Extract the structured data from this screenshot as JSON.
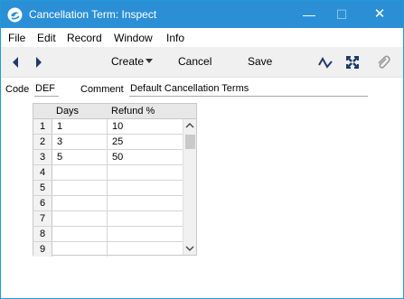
{
  "window": {
    "title": "Cancellation Term: Inspect",
    "controls": {
      "minimize": "—",
      "maximize": "☐",
      "close": "✕"
    }
  },
  "menu": {
    "items": [
      "File",
      "Edit",
      "Record",
      "Window",
      "Info"
    ]
  },
  "toolbar": {
    "create_label": "Create",
    "cancel_label": "Cancel",
    "save_label": "Save",
    "icons": [
      "prev-arrow-icon",
      "next-arrow-icon",
      "dropdown-caret-icon",
      "activity-icon",
      "expand-icon",
      "paperclip-icon"
    ]
  },
  "form": {
    "code_label": "Code",
    "code_value": "DEF",
    "comment_label": "Comment",
    "comment_value": "Default Cancellation Terms"
  },
  "grid": {
    "headers": {
      "days": "Days",
      "refund": "Refund %"
    },
    "rows": [
      {
        "num": "1",
        "days": "1",
        "refund": "10"
      },
      {
        "num": "2",
        "days": "3",
        "refund": "25"
      },
      {
        "num": "3",
        "days": "5",
        "refund": "50"
      },
      {
        "num": "4",
        "days": "",
        "refund": ""
      },
      {
        "num": "5",
        "days": "",
        "refund": ""
      },
      {
        "num": "6",
        "days": "",
        "refund": ""
      },
      {
        "num": "7",
        "days": "",
        "refund": ""
      },
      {
        "num": "8",
        "days": "",
        "refund": ""
      },
      {
        "num": "9",
        "days": "",
        "refund": ""
      }
    ]
  },
  "colors": {
    "titlebar": "#2b8fd6",
    "toolbar": "#f0f0f0",
    "grid_header": "#e7e7e7"
  }
}
